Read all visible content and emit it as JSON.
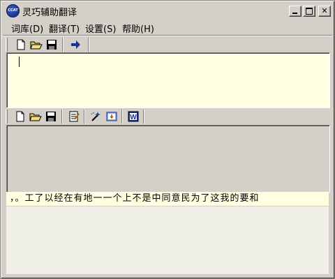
{
  "window": {
    "title": "灵巧辅助翻译",
    "app_icon_text": "CCAT"
  },
  "menu": {
    "items": [
      {
        "label": "词库(D)"
      },
      {
        "label": "翻译(T)"
      },
      {
        "label": "设置(S)"
      },
      {
        "label": "帮助(H)"
      }
    ]
  },
  "toolbar_top": {
    "icons": [
      "new-file-icon",
      "open-folder-icon",
      "save-disk-icon",
      "translate-arrow-icon"
    ]
  },
  "toolbar_mid": {
    "icons": [
      "new-file-icon",
      "open-folder-icon",
      "save-disk-icon",
      "edit-notepad-icon",
      "wizard-tool-icon",
      "import-image-icon",
      "word-document-icon"
    ]
  },
  "input_pane": {
    "text": ""
  },
  "suggestion_bar": {
    "text": "，。工了以经在有地一一个上不是中同意民为了这我的要和"
  },
  "colors": {
    "window_bg": "#d4d0c8",
    "input_bg": "#ffffe1",
    "arrow_blue": "#1c2f9e"
  }
}
